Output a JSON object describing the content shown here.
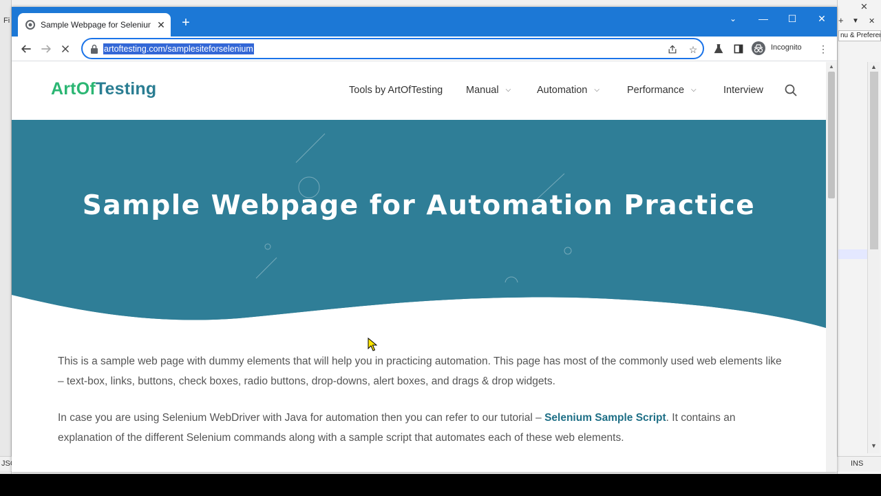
{
  "browser": {
    "tab_title": "Sample Webpage for Selenium Automation Practice",
    "url": "artoftesting.com/samplesiteforselenium",
    "incognito_label": "Incognito"
  },
  "background_app": {
    "side_tab_label": "nu & Preferenc",
    "status_left": "JSC",
    "status_right": "INS",
    "menu_letter": "Fi"
  },
  "site": {
    "logo_part1": "ArtOf",
    "logo_part2": "Testing",
    "nav": {
      "tools": "Tools by ArtOfTesting",
      "manual": "Manual",
      "automation": "Automation",
      "performance": "Performance",
      "interview": "Interview"
    }
  },
  "hero": {
    "title": "Sample Webpage for Automation Practice"
  },
  "content": {
    "p1": "This is a sample web page with dummy elements that will help you in practicing automation. This page has most of the commonly used web elements like – text-box, links, buttons, check boxes, radio buttons, drop-downs, alert boxes, and drags & drop widgets.",
    "p2_before": "In case you are using Selenium WebDriver with Java for automation then you can refer to our tutorial – ",
    "p2_link": "Selenium Sample Script",
    "p2_after": ". It contains an explanation of the different Selenium commands along with a sample script that automates each of these web elements."
  },
  "colors": {
    "titlebar": "#1c78d6",
    "hero": "#2f7e97",
    "logo_green": "#2bb673",
    "logo_teal": "#2a7d92",
    "link": "#1e6f86"
  },
  "icons": {
    "back": "arrow-left-icon",
    "forward": "arrow-right-icon",
    "stop": "close-icon",
    "lock": "lock-icon",
    "share": "share-icon",
    "bookmark": "star-icon",
    "extensions": "flask-icon",
    "sidepanel": "side-panel-icon",
    "search": "search-icon"
  }
}
